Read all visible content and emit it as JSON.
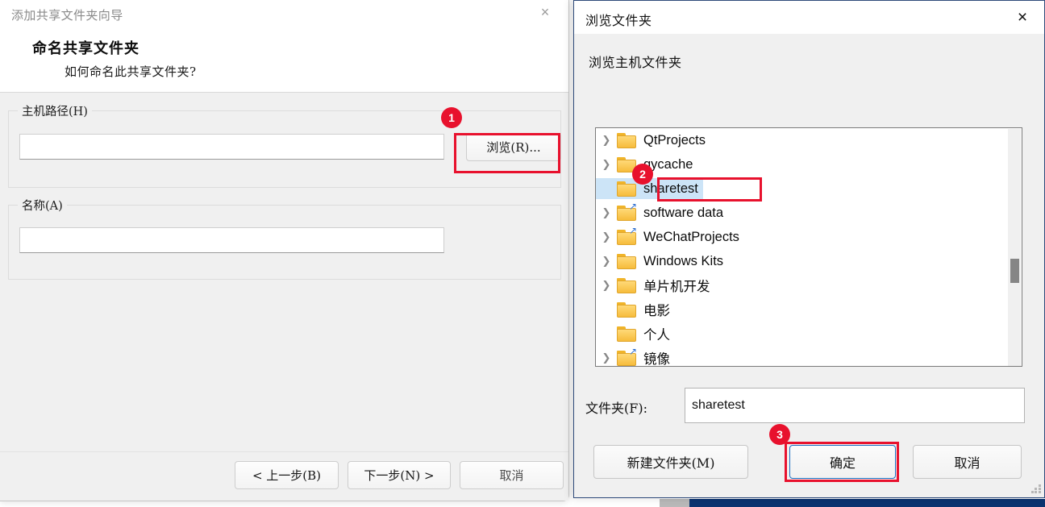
{
  "wizard": {
    "title": "添加共享文件夹向导",
    "close_icon": "×",
    "heading": "命名共享文件夹",
    "subheading": "如何命名此共享文件夹?",
    "host_path_group_label": "主机路径(H)",
    "host_path_value": "",
    "browse_button": "浏览(R)...",
    "name_group_label": "名称(A)",
    "name_value": "",
    "back_button": "< 上一步(B)",
    "next_button": "下一步(N) >",
    "cancel_button": "取消"
  },
  "browse_dialog": {
    "title": "浏览文件夹",
    "close_icon": "×",
    "prompt": "浏览主机文件夹",
    "tree_items": [
      {
        "label": "QtProjects",
        "expandable": true,
        "shortcut": false,
        "selected": false
      },
      {
        "label": "qycache",
        "expandable": true,
        "shortcut": false,
        "selected": false
      },
      {
        "label": "sharetest",
        "expandable": false,
        "shortcut": false,
        "selected": true
      },
      {
        "label": "software data",
        "expandable": true,
        "shortcut": true,
        "selected": false
      },
      {
        "label": "WeChatProjects",
        "expandable": true,
        "shortcut": true,
        "selected": false
      },
      {
        "label": "Windows Kits",
        "expandable": true,
        "shortcut": false,
        "selected": false
      },
      {
        "label": "单片机开发",
        "expandable": true,
        "shortcut": false,
        "selected": false
      },
      {
        "label": "电影",
        "expandable": false,
        "shortcut": false,
        "selected": false
      },
      {
        "label": "个人",
        "expandable": false,
        "shortcut": false,
        "selected": false
      },
      {
        "label": "镜像",
        "expandable": true,
        "shortcut": true,
        "selected": false
      }
    ],
    "folder_label": "文件夹(F):",
    "folder_value": "sharetest",
    "new_folder_button": "新建文件夹(M)",
    "ok_button": "确定",
    "cancel_button": "取消"
  },
  "annotations": {
    "badge_1": "1",
    "badge_2": "2",
    "badge_3": "3",
    "highlight_color": "#e8112d"
  }
}
